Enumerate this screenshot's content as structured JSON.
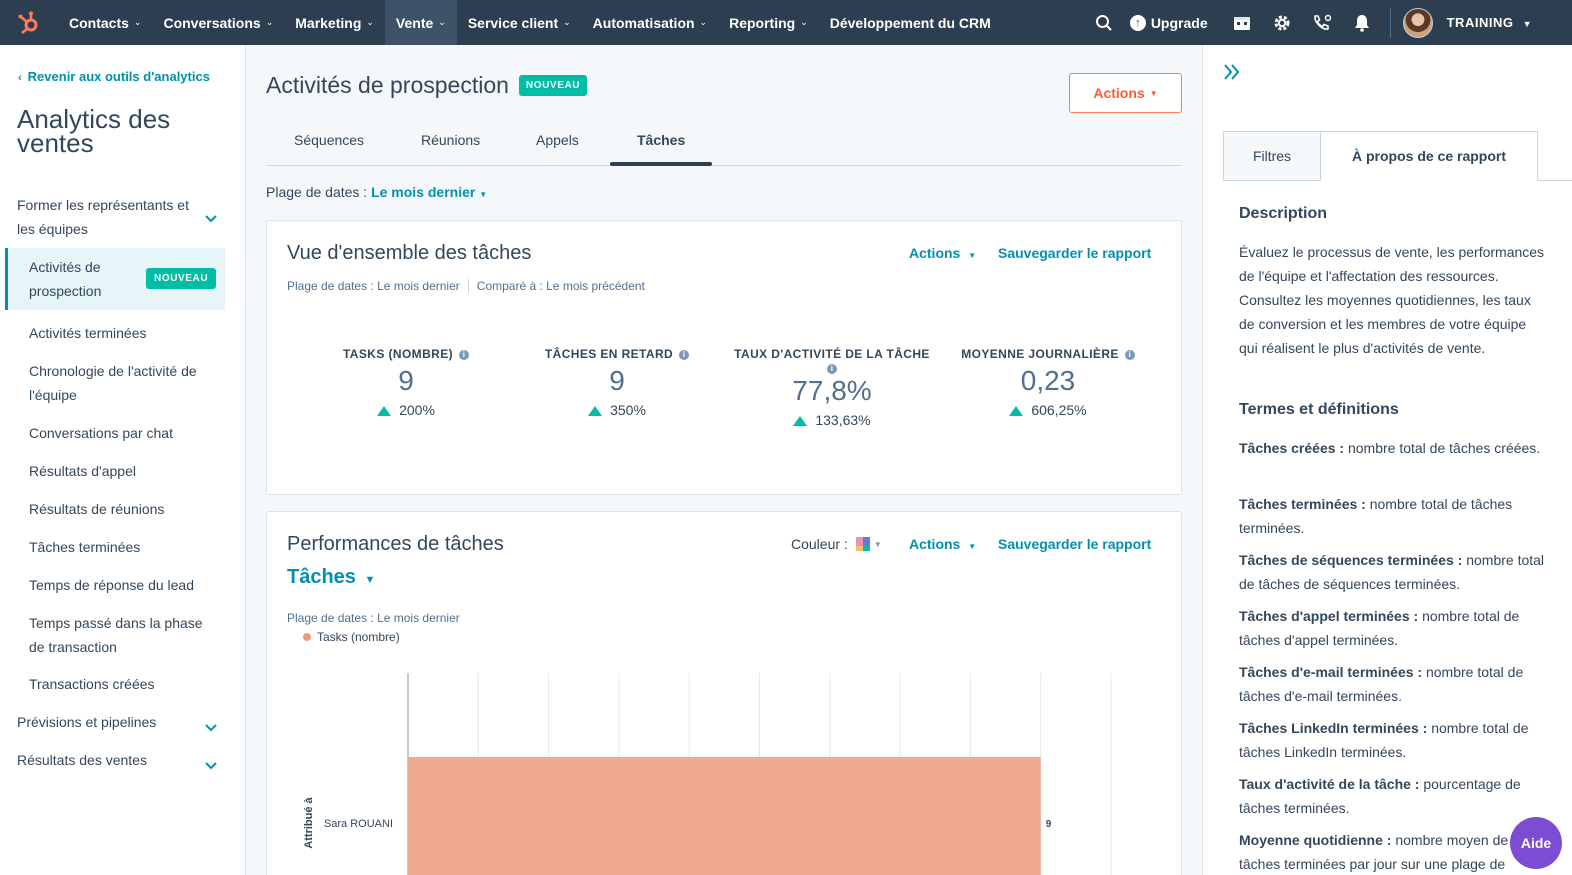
{
  "nav": {
    "items": [
      {
        "label": "Contacts",
        "caret": true
      },
      {
        "label": "Conversations",
        "caret": true
      },
      {
        "label": "Marketing",
        "caret": true
      },
      {
        "label": "Vente",
        "caret": true
      },
      {
        "label": "Service client",
        "caret": true
      },
      {
        "label": "Automatisation",
        "caret": true
      },
      {
        "label": "Reporting",
        "caret": true
      },
      {
        "label": "Développement du CRM",
        "caret": false
      }
    ],
    "upgrade_label": "Upgrade",
    "account_label": "TRAINING"
  },
  "sidebar": {
    "back_link": "Revenir aux outils d'analytics",
    "title": "Analytics des ventes",
    "group1": "Former les représentants et les équipes",
    "active_item": "Activités de prospection",
    "active_badge": "NOUVEAU",
    "items": [
      "Activités terminées",
      "Chronologie de l'activité de l'équipe",
      "Conversations par chat",
      "Résultats d'appel",
      "Résultats de réunions",
      "Tâches terminées",
      "Temps de réponse du lead",
      "Temps passé dans la phase de transaction",
      "Transactions créées"
    ],
    "group2": "Prévisions et pipelines",
    "group3": "Résultats des ventes"
  },
  "main": {
    "title": "Activités de prospection",
    "title_badge": "NOUVEAU",
    "actions_button": "Actions",
    "tabs": [
      "Séquences",
      "Réunions",
      "Appels",
      "Tâches"
    ],
    "date_range_label": "Plage de dates :",
    "date_range_value": "Le mois dernier"
  },
  "overview": {
    "title": "Vue d'ensemble des tâches",
    "actions": "Actions",
    "save": "Sauvegarder le rapport",
    "meta_range": "Plage de dates : Le mois dernier",
    "meta_compare": "Comparé à : Le mois précédent",
    "kpis": [
      {
        "label": "TASKS (NOMBRE)",
        "value": "9",
        "delta": "200%"
      },
      {
        "label": "TÂCHES EN RETARD",
        "value": "9",
        "delta": "350%"
      },
      {
        "label": "TAUX D'ACTIVITÉ DE LA TÂCHE",
        "value": "77,8%",
        "delta": "133,63%"
      },
      {
        "label": "MOYENNE JOURNALIÈRE",
        "value": "0,23",
        "delta": "606,25%"
      }
    ]
  },
  "performance": {
    "title": "Performances de tâches",
    "color_label": "Couleur :",
    "actions": "Actions",
    "save": "Sauvegarder le rapport",
    "dropdown": "Tâches",
    "meta_range": "Plage de dates : Le mois dernier"
  },
  "chart_data": {
    "type": "bar",
    "orientation": "horizontal",
    "categories": [
      "Sara ROUANI"
    ],
    "series": [
      {
        "name": "Tasks (nombre)",
        "values": [
          9
        ],
        "color": "#f0aa90"
      }
    ],
    "ylabel": "Attribué à",
    "xlim": [
      0,
      10
    ],
    "value_labels": [
      "9"
    ],
    "grid": true
  },
  "right_panel": {
    "tabs": [
      "Filtres",
      "À propos de ce rapport"
    ],
    "description_title": "Description",
    "description": "Évaluez le processus de vente, les performances de l'équipe et l'affectation des ressources. Consultez les moyennes quotidiennes, les taux de conversion et les membres de votre équipe qui réalisent le plus d'activités de vente.",
    "terms_title": "Termes et définitions",
    "terms": [
      {
        "term": "Tâches créées :",
        "def": "nombre total de tâches créées."
      },
      {
        "term": "Tâches terminées :",
        "def": "nombre total de tâches terminées."
      },
      {
        "term": "Tâches de séquences terminées :",
        "def": "nombre total de tâches de séquences terminées."
      },
      {
        "term": "Tâches d'appel terminées :",
        "def": "nombre total de tâches d'appel terminées."
      },
      {
        "term": "Tâches d'e-mail terminées :",
        "def": "nombre total de tâches d'e-mail terminées."
      },
      {
        "term": "Tâches LinkedIn terminées :",
        "def": "nombre total de tâches LinkedIn terminées."
      },
      {
        "term": "Taux d'activité de la tâche :",
        "def": "pourcentage de tâches terminées."
      },
      {
        "term": "Moyenne quotidienne :",
        "def": "nombre moyen de tâches terminées par jour sur une plage de"
      }
    ]
  },
  "help_button": "Aide",
  "colors": {
    "nav_bg": "#2d3e50",
    "accent": "#0091ae",
    "brand_orange": "#ff7a59",
    "teal": "#00bda5",
    "bar": "#f0aa90"
  }
}
